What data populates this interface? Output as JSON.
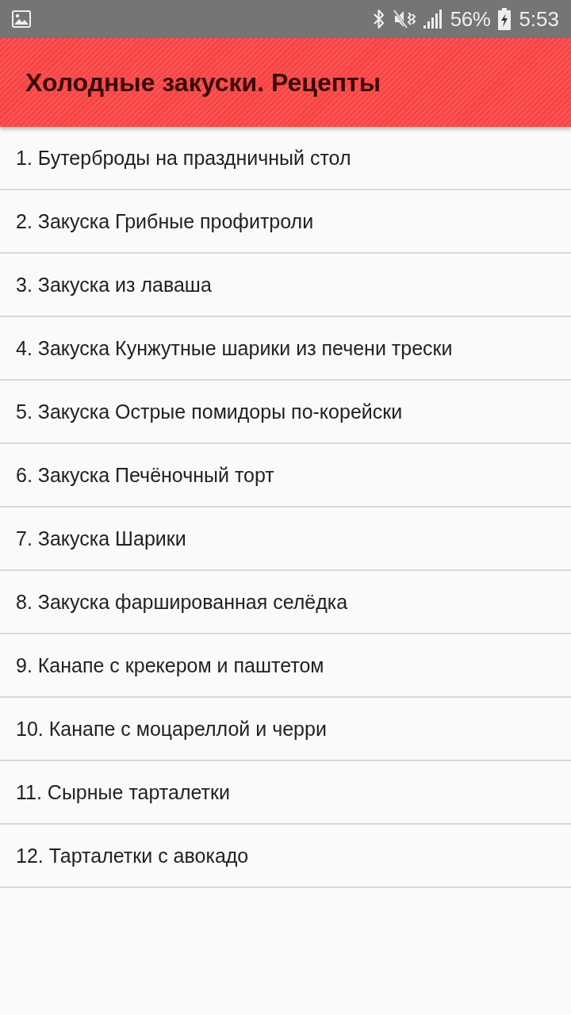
{
  "status_bar": {
    "battery": "56%",
    "time": "5:53"
  },
  "app_bar": {
    "title": "Холодные закуски. Рецепты"
  },
  "recipes": [
    {
      "title": "1. Бутерброды на праздничный стол"
    },
    {
      "title": "2. Закуска Грибные профитроли"
    },
    {
      "title": "3. Закуска из лаваша"
    },
    {
      "title": "4. Закуска Кунжутные шарики из печени трески"
    },
    {
      "title": "5. Закуска Острые помидоры по-корейски"
    },
    {
      "title": "6. Закуска Печёночный торт"
    },
    {
      "title": "7. Закуска Шарики"
    },
    {
      "title": "8. Закуска фаршированная селёдка"
    },
    {
      "title": "9. Канапе с крекером и паштетом"
    },
    {
      "title": "10. Канапе с моцареллой и черри"
    },
    {
      "title": "11. Сырные тарталетки"
    },
    {
      "title": "12. Тарталетки с авокадо"
    }
  ]
}
